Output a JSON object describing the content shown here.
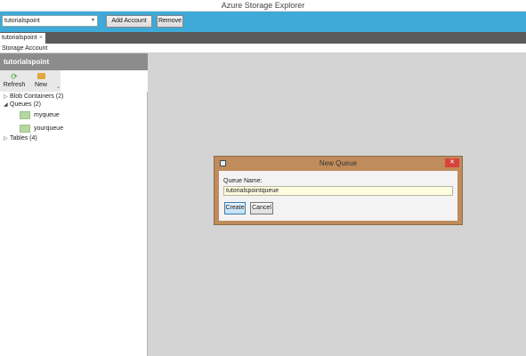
{
  "window": {
    "title": "Azure Storage Explorer"
  },
  "toolbar": {
    "account_selected": "tutorialspoint",
    "add_account_label": "Add Account",
    "remove_label": "Remove"
  },
  "tabs": [
    {
      "label": "tutorialspoint",
      "close": "×"
    }
  ],
  "breadcrumb": "Storage Account",
  "sidebar": {
    "header": "tutorialspoint",
    "ribbon": {
      "refresh_label": "Refresh",
      "new_label": "New",
      "more": "⌄"
    },
    "tree": {
      "blob_containers": {
        "label": "Blob Containers (2)",
        "expander": "▷"
      },
      "queues": {
        "label": "Queues (2)",
        "expander": "◢",
        "items": [
          "myqueue",
          "yourqueue"
        ]
      },
      "tables": {
        "label": "Tables (4)",
        "expander": "▷"
      }
    }
  },
  "dialog": {
    "title": "New Queue",
    "close": "✕",
    "field_label": "Queue Name:",
    "field_value": "tutorialspointqueue",
    "create_label": "Create",
    "cancel_label": "Cancel"
  }
}
